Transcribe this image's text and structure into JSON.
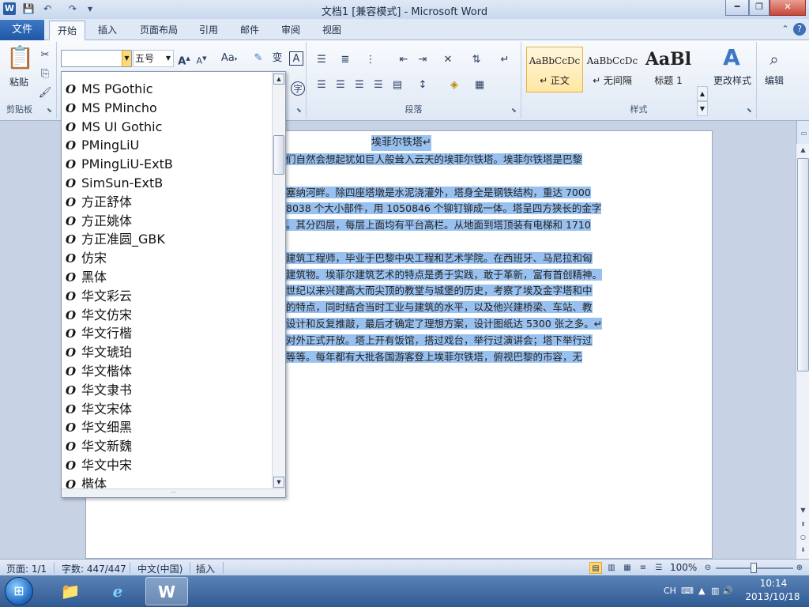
{
  "window": {
    "title": "文档1 [兼容模式]  -  Microsoft Word",
    "icon_letter": "W"
  },
  "tabs": {
    "file": "文件",
    "items": [
      "开始",
      "插入",
      "页面布局",
      "引用",
      "邮件",
      "审阅",
      "视图"
    ],
    "active": "开始"
  },
  "ribbon": {
    "clipboard": {
      "paste_label": "粘贴",
      "group_label": "剪贴板"
    },
    "font": {
      "font_name_value": "",
      "font_size_value": "五号",
      "change_case_label": "Aa",
      "grow_label": "A",
      "shrink_label": "A"
    },
    "paragraph": {
      "group_label": "段落"
    },
    "styles": {
      "group_label": "样式",
      "tiles": [
        {
          "sample": "AaBbCcDc",
          "name": "↵ 正文"
        },
        {
          "sample": "AaBbCcDc",
          "name": "↵ 无间隔"
        },
        {
          "sample": "AaBl",
          "name": "标题 1"
        }
      ],
      "change_styles_label": "更改样式"
    },
    "editing": {
      "label": "编辑"
    }
  },
  "font_list": [
    {
      "name": "MS PGothic"
    },
    {
      "name": "MS PMincho"
    },
    {
      "name": "MS UI Gothic"
    },
    {
      "name": "PMingLiU"
    },
    {
      "name": "PMingLiU-ExtB"
    },
    {
      "name": "SimSun-ExtB"
    },
    {
      "name": "方正舒体"
    },
    {
      "name": "方正姚体"
    },
    {
      "name": "方正准圆_GBK"
    },
    {
      "name": "仿宋"
    },
    {
      "name": "黑体"
    },
    {
      "name": "华文彩云"
    },
    {
      "name": "华文仿宋"
    },
    {
      "name": "华文行楷"
    },
    {
      "name": "华文琥珀"
    },
    {
      "name": "华文楷体"
    },
    {
      "name": "华文隶书"
    },
    {
      "name": "华文宋体"
    },
    {
      "name": "华文细黑"
    },
    {
      "name": "华文新魏"
    },
    {
      "name": "华文中宋"
    },
    {
      "name": "楷体"
    }
  ],
  "document": {
    "title": "埃菲尔铁塔↵",
    "lines": [
      "们自然会想起犹如巨人般耸入云天的埃菲尔铁塔。埃菲尔铁塔是巴黎",
      "",
      "塞纳河畔。除四座塔墩是水泥浇灌外，塔身全是钢铁结构，重达  7000",
      "8038 个大小部件，用 1050846 个铆钉铆成一体。塔呈四方狭长的金字",
      "。其分四层，每层上面均有平台高栏。从地面到塔顶装有电梯和  1710",
      "",
      "建筑工程师，毕业于巴黎中央工程和艺术学院。在西班牙、马尼拉和匈",
      "建筑物。埃菲尔建筑艺术的特点是勇于实践，敢于革新，富有首创精神。",
      "世纪以来兴建高大而尖顶的教堂与城堡的历史，考察了埃及金字塔和中",
      "的特点，同时结合当时工业与建筑的水平，以及他兴建桥梁、车站、教",
      "设计和反复推敲，最后才确定了理想方案，设计图纸达 5300 张之多。↵",
      "对外正式开放。塔上开有饭馆，搭过戏台，举行过演讲会；塔下举行过",
      "等等。每年都有大批各国游客登上埃菲尔铁塔，俯视巴黎的市容，无"
    ]
  },
  "statusbar": {
    "page": "页面: 1/1",
    "words": "字数: 447/447",
    "language": "中文(中国)",
    "mode": "插入",
    "zoom": "100%",
    "zoom_percent": 100
  },
  "taskbar": {
    "ime": "CH",
    "time": "10:14",
    "date": "2013/10/18"
  }
}
